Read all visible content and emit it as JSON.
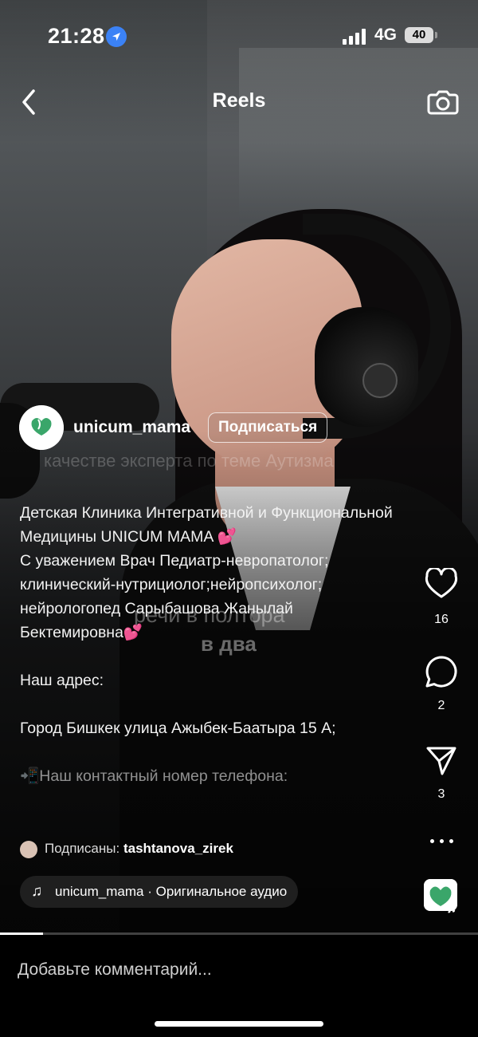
{
  "status_bar": {
    "time": "21:28",
    "network": "4G",
    "battery": "40"
  },
  "header": {
    "title": "Reels",
    "back_icon": "chevron-left-icon",
    "camera_icon": "camera-icon"
  },
  "video_overlay": {
    "line_top": "качестве эксперта по теме Аутизма",
    "line_mid": "речи в полтора",
    "line_mid2": "в два"
  },
  "author": {
    "username": "unicum_mama",
    "follow_label": "Подписаться",
    "avatar_text": "Unicum Mama"
  },
  "caption": {
    "lines": [
      "Детская Клиника Интегративной и Функциональной Медицины UNICUM MAMA 💕",
      "С уважением Врач Педиатр-невропатолог; клинический-нутрициолог;нейропсихолог; нейрологопед Сарыбашова Жанылай Бектемировна💕",
      "",
      "Наш адрес:",
      "",
      "Город Бишкек улица Ажыбек-Баатыра 15 А;",
      "",
      "📲Наш контактный номер телефона:"
    ]
  },
  "followed_by": {
    "prefix": "Подписаны:",
    "username": "tashtanova_zirek"
  },
  "audio": {
    "label": "unicum_mama · Оригинальное аудио"
  },
  "actions": {
    "likes": "16",
    "comments": "2",
    "shares": "3",
    "like_icon": "heart-icon",
    "comment_icon": "comment-bubble-icon",
    "share_icon": "send-icon",
    "more_icon": "more-dots-icon"
  },
  "progress": 0.09,
  "comment_placeholder": "Добавьте комментарий..."
}
